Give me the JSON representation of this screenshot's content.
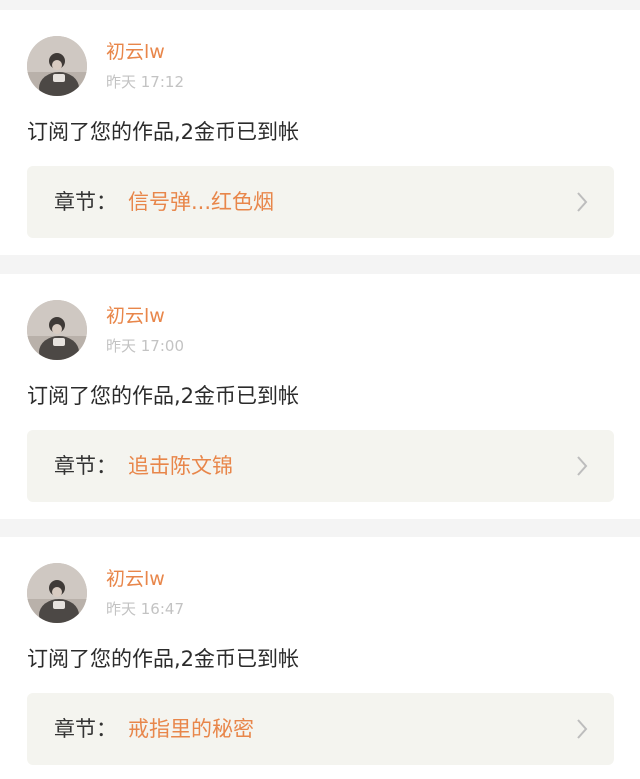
{
  "notifications": [
    {
      "user": "初云lw",
      "time": "昨天 17:12",
      "message": "订阅了您的作品,2金币已到帐",
      "chapter_label": "章节：",
      "chapter_title": "信号弹...红色烟"
    },
    {
      "user": "初云lw",
      "time": "昨天 17:00",
      "message": "订阅了您的作品,2金币已到帐",
      "chapter_label": "章节：",
      "chapter_title": "追击陈文锦"
    },
    {
      "user": "初云lw",
      "time": "昨天 16:47",
      "message": "订阅了您的作品,2金币已到帐",
      "chapter_label": "章节：",
      "chapter_title": "戒指里的秘密"
    }
  ],
  "icons": {
    "avatar": "avatar-image",
    "chevron": "chevron-right-icon"
  },
  "colors": {
    "accent": "#e8864a",
    "text": "#2b2b2b",
    "muted": "#c3c3c3",
    "chapter_bg": "#f4f4ef",
    "divider": "#f4f4f4"
  }
}
